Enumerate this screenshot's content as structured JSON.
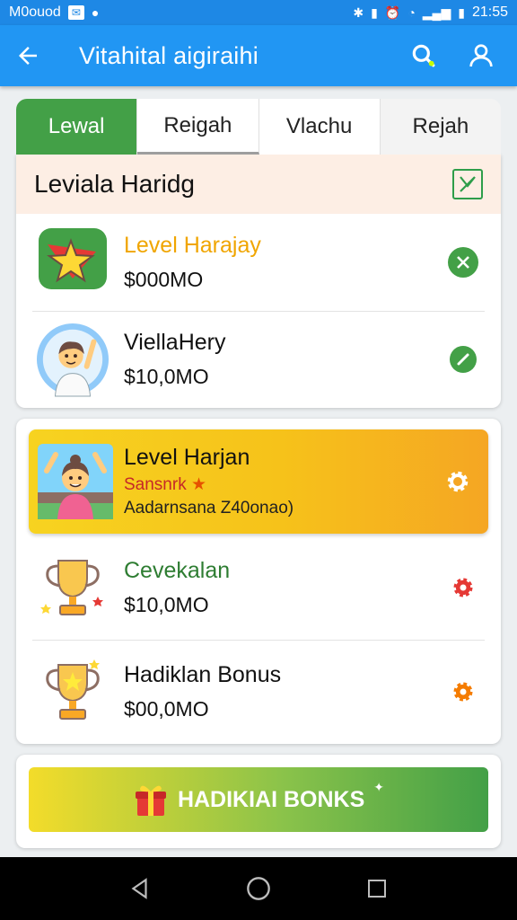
{
  "status_bar": {
    "carrier": "M0ouod",
    "time": "21:55"
  },
  "app_bar": {
    "title": "Vitahital aigiraihi"
  },
  "tabs": [
    {
      "label": "Lewal"
    },
    {
      "label": "Reigah"
    },
    {
      "label": "Vlachu"
    },
    {
      "label": "Rejah"
    }
  ],
  "section": {
    "title": "Leviala Haridg",
    "items": [
      {
        "name": "Level Harajay",
        "amount": "$000MO",
        "name_color": "#f0a500"
      },
      {
        "name": "ViellaHery",
        "amount": "$10,0MO",
        "name_color": "#111111"
      }
    ]
  },
  "highlight": {
    "name": "Level Harjan",
    "subtitle": "Sansnrk",
    "detail": "Aadarnsana Z40onao)"
  },
  "list": [
    {
      "name": "Cevekalan",
      "amount": "$10,0MO",
      "name_color": "#2e7d32"
    },
    {
      "name": "Hadiklan Bonus",
      "amount": "$00,0MO",
      "name_color": "#111111"
    }
  ],
  "bonus_button": {
    "label": "HADIKIAI BONKS"
  },
  "colors": {
    "primary": "#2196f3",
    "accent": "#43a047",
    "highlight": "#f6c21a"
  }
}
